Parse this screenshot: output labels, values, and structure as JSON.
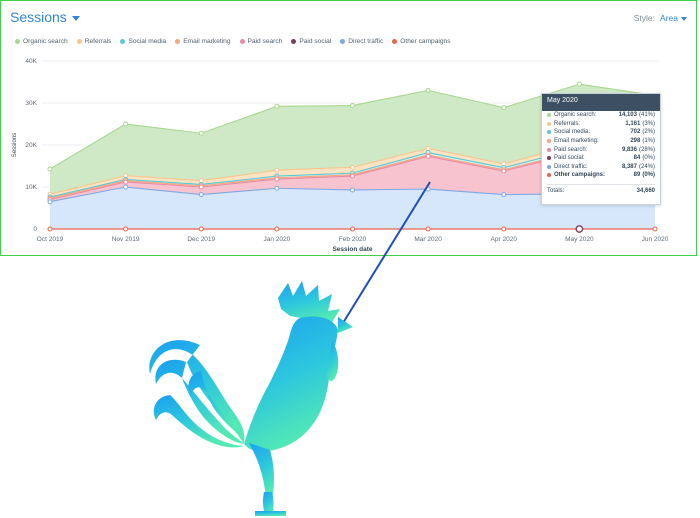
{
  "header": {
    "title": "Sessions",
    "style_label": "Style:",
    "style_value": "Area"
  },
  "colors": {
    "frame": "#3fd24a",
    "organic": "#cfe8c6",
    "organic_line": "#a7d890",
    "referrals": "#f7c68c",
    "social": "#5cc8d1",
    "email": "#f3a57e",
    "paid_search": "#f6c3cf",
    "paid_search_line": "#e98aa3",
    "paid_social": "#7d3c59",
    "direct": "#d6e6fb",
    "direct_line": "#7fa9e5",
    "other": "#e8654a",
    "pointer_line": "#1f4fb8"
  },
  "legend": [
    {
      "label": "Organic search",
      "color": "#a7d890"
    },
    {
      "label": "Referrals",
      "color": "#f7c68c"
    },
    {
      "label": "Social media",
      "color": "#5cc8d1"
    },
    {
      "label": "Email marketing",
      "color": "#f3a57e"
    },
    {
      "label": "Paid search",
      "color": "#e98aa3"
    },
    {
      "label": "Paid social",
      "color": "#7d3c59"
    },
    {
      "label": "Direct traffic",
      "color": "#7fa9e5"
    },
    {
      "label": "Other campaigns",
      "color": "#e8654a"
    }
  ],
  "chart_data": {
    "type": "area",
    "stacked": true,
    "title": "Sessions",
    "xlabel": "Session date",
    "ylabel": "Sessions",
    "categories": [
      "Oct 2019",
      "Nov 2019",
      "Dec 2019",
      "Jan 2020",
      "Feb 2020",
      "Mar 2020",
      "Apr 2020",
      "May 2020",
      "Jun 2020"
    ],
    "yticks": [
      "0",
      "10K",
      "20K",
      "30K",
      "40K"
    ],
    "ylim": [
      0,
      40000
    ],
    "grid": true,
    "legend_position": "top",
    "series": [
      {
        "name": "Direct traffic",
        "values": [
          6500,
          10000,
          8200,
          9700,
          9300,
          9500,
          8200,
          8387,
          11000
        ]
      },
      {
        "name": "Paid social",
        "values": [
          0,
          0,
          0,
          0,
          0,
          0,
          0,
          84,
          0
        ]
      },
      {
        "name": "Paid search",
        "values": [
          500,
          1200,
          1800,
          2200,
          3300,
          7800,
          5600,
          9836,
          1200
        ]
      },
      {
        "name": "Email marketing",
        "values": [
          300,
          300,
          300,
          300,
          300,
          300,
          300,
          298,
          300
        ]
      },
      {
        "name": "Social media",
        "values": [
          300,
          300,
          300,
          400,
          400,
          600,
          500,
          702,
          500
        ]
      },
      {
        "name": "Referrals",
        "values": [
          700,
          900,
          900,
          1400,
          1400,
          1000,
          900,
          1161,
          2200
        ]
      },
      {
        "name": "Organic search",
        "values": [
          6000,
          12300,
          11300,
          15200,
          14700,
          13800,
          13400,
          14103,
          16600
        ]
      },
      {
        "name": "Other campaigns",
        "values": [
          0,
          0,
          0,
          0,
          0,
          0,
          0,
          89,
          0
        ]
      }
    ],
    "tooltip": {
      "title": "May 2020",
      "rows": [
        {
          "name": "Organic search:",
          "value": "14,103",
          "pct": "(41%)",
          "color": "#a7d890",
          "bold": false
        },
        {
          "name": "Referrals:",
          "value": "1,161",
          "pct": "(3%)",
          "color": "#f7c68c",
          "bold": false
        },
        {
          "name": "Social media:",
          "value": "702",
          "pct": "(2%)",
          "color": "#5cc8d1",
          "bold": false
        },
        {
          "name": "Email marketing:",
          "value": "298",
          "pct": "(1%)",
          "color": "#f3a57e",
          "bold": false
        },
        {
          "name": "Paid search:",
          "value": "9,836",
          "pct": "(28%)",
          "color": "#e98aa3",
          "bold": false
        },
        {
          "name": "Paid social:",
          "value": "84",
          "pct": "(0%)",
          "color": "#7d3c59",
          "bold": false
        },
        {
          "name": "Direct traffic:",
          "value": "8,387",
          "pct": "(24%)",
          "color": "#7fa9e5",
          "bold": false
        },
        {
          "name": "Other campaigns:",
          "value": "89",
          "pct": "(0%)",
          "color": "#e8654a",
          "bold": true
        }
      ],
      "total_label": "Totals:",
      "total_value": "34,660"
    }
  },
  "graphics": {
    "logo_icon": "rooster-icon",
    "logo_gradient": [
      "#1aa0ef",
      "#2dc7de",
      "#52e9b4"
    ]
  }
}
